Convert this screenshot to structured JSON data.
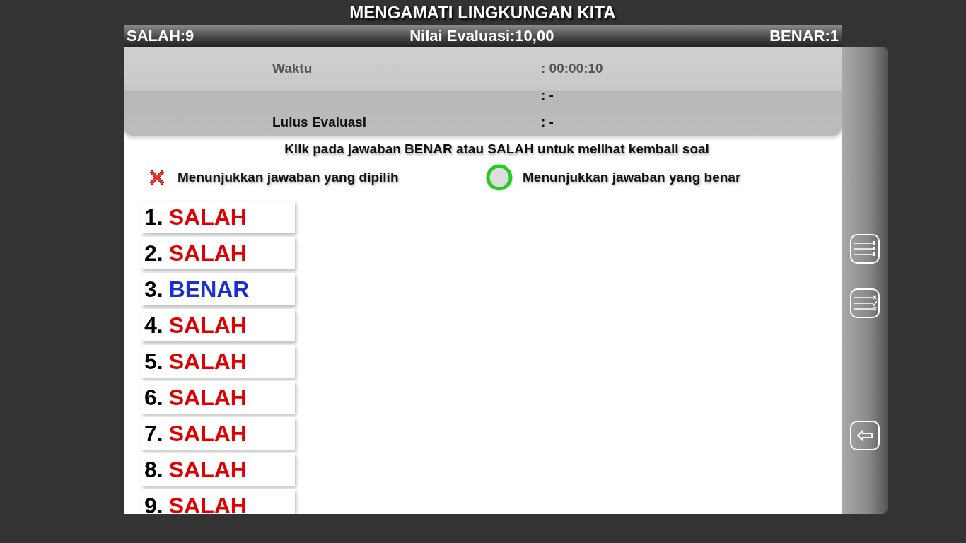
{
  "title": "MENGAMATI LINGKUNGAN KITA",
  "score_bar": {
    "wrong": "SALAH:9",
    "score": "Nilai Evaluasi:10,00",
    "right": "BENAR:1"
  },
  "summary": [
    {
      "label": "Waktu",
      "value": ": 00:00:10",
      "muted": true
    },
    {
      "value": ": -",
      "muted": false
    },
    {
      "label": "Lulus Evaluasi",
      "value": ": -",
      "muted": false
    }
  ],
  "instruction": "Klik pada jawaban BENAR atau SALAH untuk melihat kembali soal",
  "legend": [
    {
      "kind": "chosen",
      "text": "Menunjukkan jawaban yang dipilih"
    },
    {
      "kind": "correct",
      "text": "Menunjukkan jawaban yang benar"
    }
  ],
  "answers": [
    {
      "number": "1.",
      "result": "SALAH",
      "correct": false
    },
    {
      "number": "2.",
      "result": "SALAH",
      "correct": false
    },
    {
      "number": "3.",
      "result": "BENAR",
      "correct": true
    },
    {
      "number": "4.",
      "result": "SALAH",
      "correct": false
    },
    {
      "number": "5.",
      "result": "SALAH",
      "correct": false
    },
    {
      "number": "6.",
      "result": "SALAH",
      "correct": false
    },
    {
      "number": "7.",
      "result": "SALAH",
      "correct": false
    },
    {
      "number": "8.",
      "result": "SALAH",
      "correct": false
    },
    {
      "number": "9.",
      "result": "SALAH",
      "correct": false
    }
  ]
}
